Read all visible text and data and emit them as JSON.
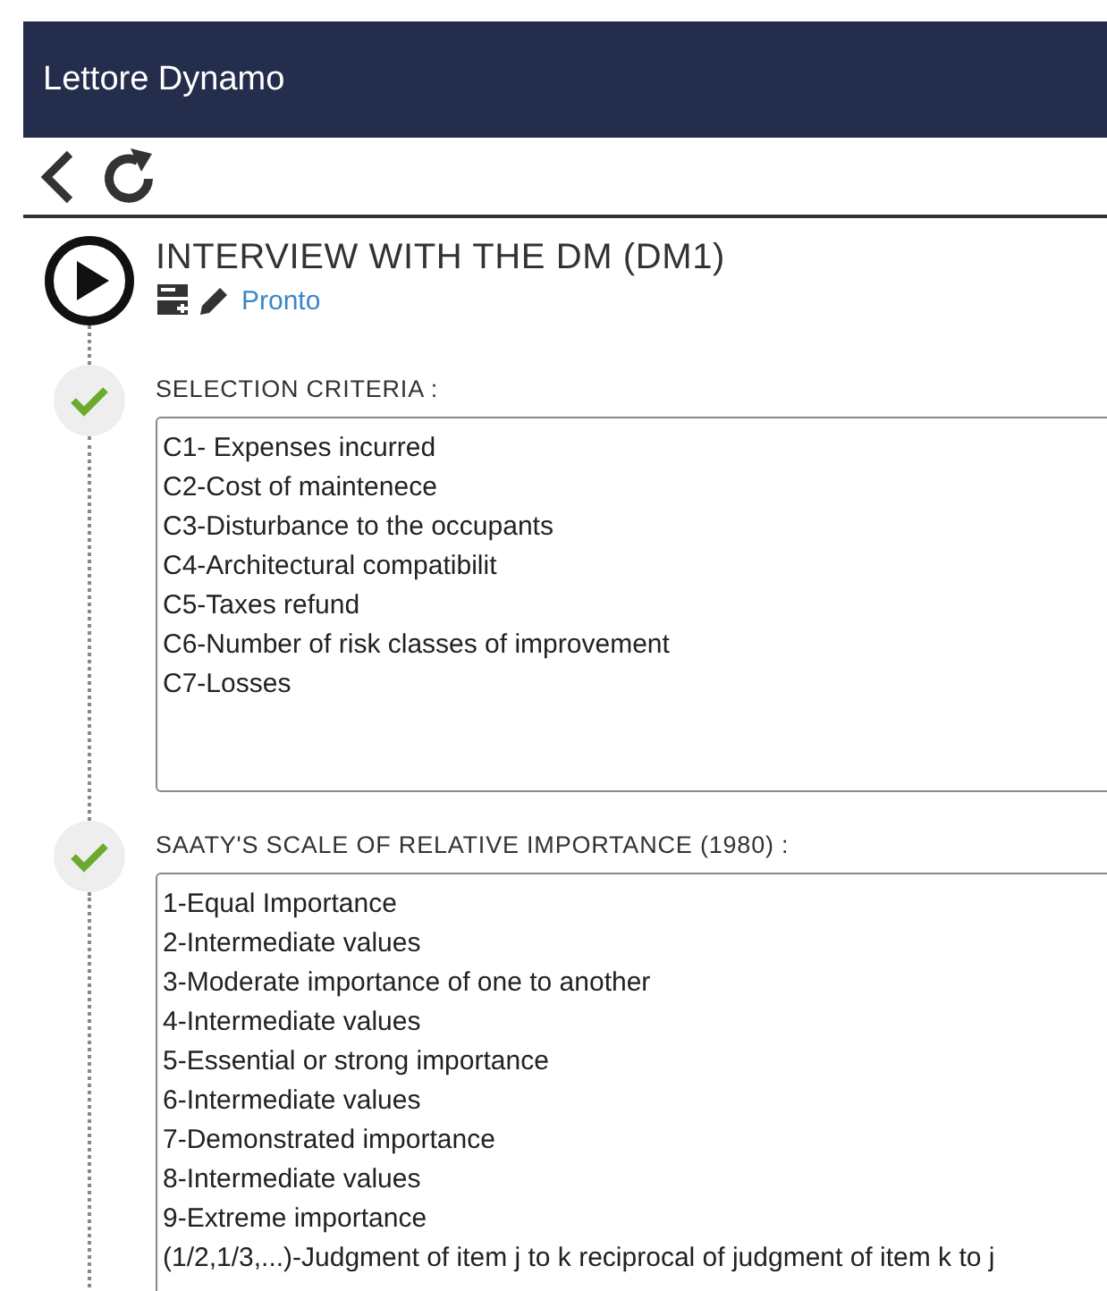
{
  "app_bar": {
    "title": "Lettore Dynamo"
  },
  "activity": {
    "title": "INTERVIEW WITH THE DM (DM1)",
    "status": "Pronto"
  },
  "steps": [
    {
      "label": "SELECTION CRITERIA :",
      "completed": true,
      "lines": [
        "C1- Expenses incurred",
        "C2-Cost of maintenece",
        "C3-Disturbance to the occupants",
        "C4-Architectural compatibilit",
        "C5-Taxes refund",
        "C6-Number of risk classes of improvement",
        "C7-Losses"
      ]
    },
    {
      "label": "SAATY'S SCALE OF RELATIVE IMPORTANCE (1980) :",
      "completed": true,
      "lines": [
        "1-Equal Importance",
        "2-Intermediate values",
        "3-Moderate importance of one to another",
        "4-Intermediate values",
        "5-Essential or strong importance",
        "6-Intermediate values",
        "7-Demonstrated importance",
        "8-Intermediate values",
        "9-Extreme importance",
        "(1/2,1/3,...)-Judgment of item j to k reciprocal of judgment of item k to j"
      ]
    }
  ]
}
